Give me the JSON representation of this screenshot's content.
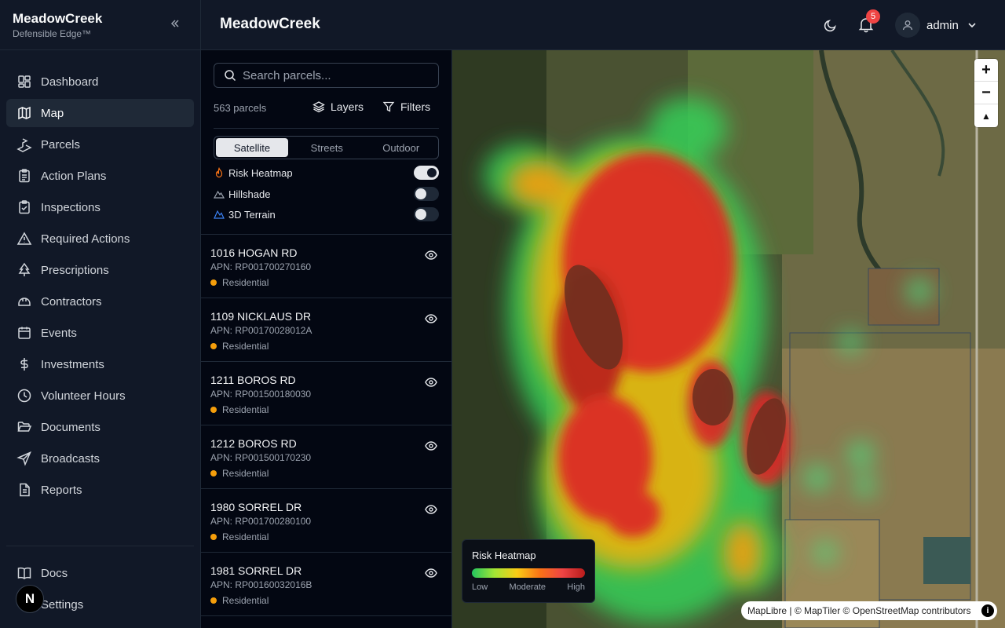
{
  "app": {
    "brand": "MeadowCreek",
    "tagline": "Defensible Edge™",
    "collapse_icon": "double-chevron-left-icon"
  },
  "header": {
    "title": "MeadowCreek",
    "notifications": "5",
    "user": "admin"
  },
  "sidebar": {
    "items": [
      {
        "label": "Dashboard",
        "icon": "grid-icon"
      },
      {
        "label": "Map",
        "icon": "map-icon",
        "active": true
      },
      {
        "label": "Parcels",
        "icon": "land-plot-icon"
      },
      {
        "label": "Action Plans",
        "icon": "clipboard-list-icon"
      },
      {
        "label": "Inspections",
        "icon": "clipboard-check-icon"
      },
      {
        "label": "Required Actions",
        "icon": "alert-triangle-icon"
      },
      {
        "label": "Prescriptions",
        "icon": "tree-icon"
      },
      {
        "label": "Contractors",
        "icon": "hard-hat-icon"
      },
      {
        "label": "Events",
        "icon": "calendar-icon"
      },
      {
        "label": "Investments",
        "icon": "dollar-icon"
      },
      {
        "label": "Volunteer Hours",
        "icon": "clock-icon"
      },
      {
        "label": "Documents",
        "icon": "folder-open-icon"
      },
      {
        "label": "Broadcasts",
        "icon": "send-icon"
      },
      {
        "label": "Reports",
        "icon": "file-text-icon"
      }
    ],
    "bottom": [
      {
        "label": "Docs",
        "icon": "book-icon"
      },
      {
        "label": "Settings",
        "icon": "gear-icon"
      }
    ],
    "n_badge": "N"
  },
  "panel": {
    "search_placeholder": "Search parcels...",
    "count": "563 parcels",
    "layers_label": "Layers",
    "filters_label": "Filters",
    "basemaps": [
      "Satellite",
      "Streets",
      "Outdoor"
    ],
    "basemap_selected": "Satellite",
    "toggles": [
      {
        "label": "Risk Heatmap",
        "on": true,
        "color": "#f97316"
      },
      {
        "label": "Hillshade",
        "on": false,
        "color": "#9ca3af"
      },
      {
        "label": "3D Terrain",
        "on": false,
        "color": "#3b82f6"
      }
    ],
    "parcels": [
      {
        "address": "1016 HOGAN RD",
        "apn": "APN: RP001700270160",
        "type": "Residential"
      },
      {
        "address": "1109 NICKLAUS DR",
        "apn": "APN: RP00170028012A",
        "type": "Residential"
      },
      {
        "address": "1211 BOROS RD",
        "apn": "APN: RP001500180030",
        "type": "Residential"
      },
      {
        "address": "1212 BOROS RD",
        "apn": "APN: RP001500170230",
        "type": "Residential"
      },
      {
        "address": "1980 SORREL DR",
        "apn": "APN: RP001700280100",
        "type": "Residential"
      },
      {
        "address": "1981 SORREL DR",
        "apn": "APN: RP00160032016B",
        "type": "Residential"
      }
    ]
  },
  "map": {
    "zoom_in": "+",
    "zoom_out": "−",
    "compass": "▲",
    "legend": {
      "title": "Risk Heatmap",
      "low": "Low",
      "mid": "Moderate",
      "high": "High"
    },
    "attribution": "MapLibre | © MapTiler © OpenStreetMap contributors",
    "info": "i"
  }
}
